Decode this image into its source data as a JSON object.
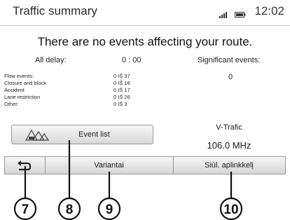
{
  "header": {
    "title": "Traffic summary",
    "clock": "12:02"
  },
  "message": "There are no events affecting your route.",
  "summary": {
    "all_delay_label": "All delay:",
    "all_delay_value": "0 : 00",
    "significant_label": "Significant events:",
    "significant_value": "0"
  },
  "events": [
    {
      "label": "Flow events:",
      "value": "0 IŠ 37"
    },
    {
      "label": "Closure and block",
      "value": "0 IŠ 16"
    },
    {
      "label": "Accident",
      "value": "0 IŠ 17"
    },
    {
      "label": "Lane restriction",
      "value": "0 IŠ 26"
    },
    {
      "label": "Other:",
      "value": "0 IŠ 3"
    }
  ],
  "event_list_button": {
    "label": "Event list",
    "icon": "traffic-event-icon"
  },
  "station": {
    "name": "V-Trafic",
    "frequency": "106.0 MHz"
  },
  "bottom_bar": {
    "back_icon": "back-arrow-icon",
    "variant_label": "Variantai",
    "settings_label": "Siūl. aplinkkelį"
  },
  "callouts": [
    "7",
    "8",
    "9",
    "10"
  ]
}
